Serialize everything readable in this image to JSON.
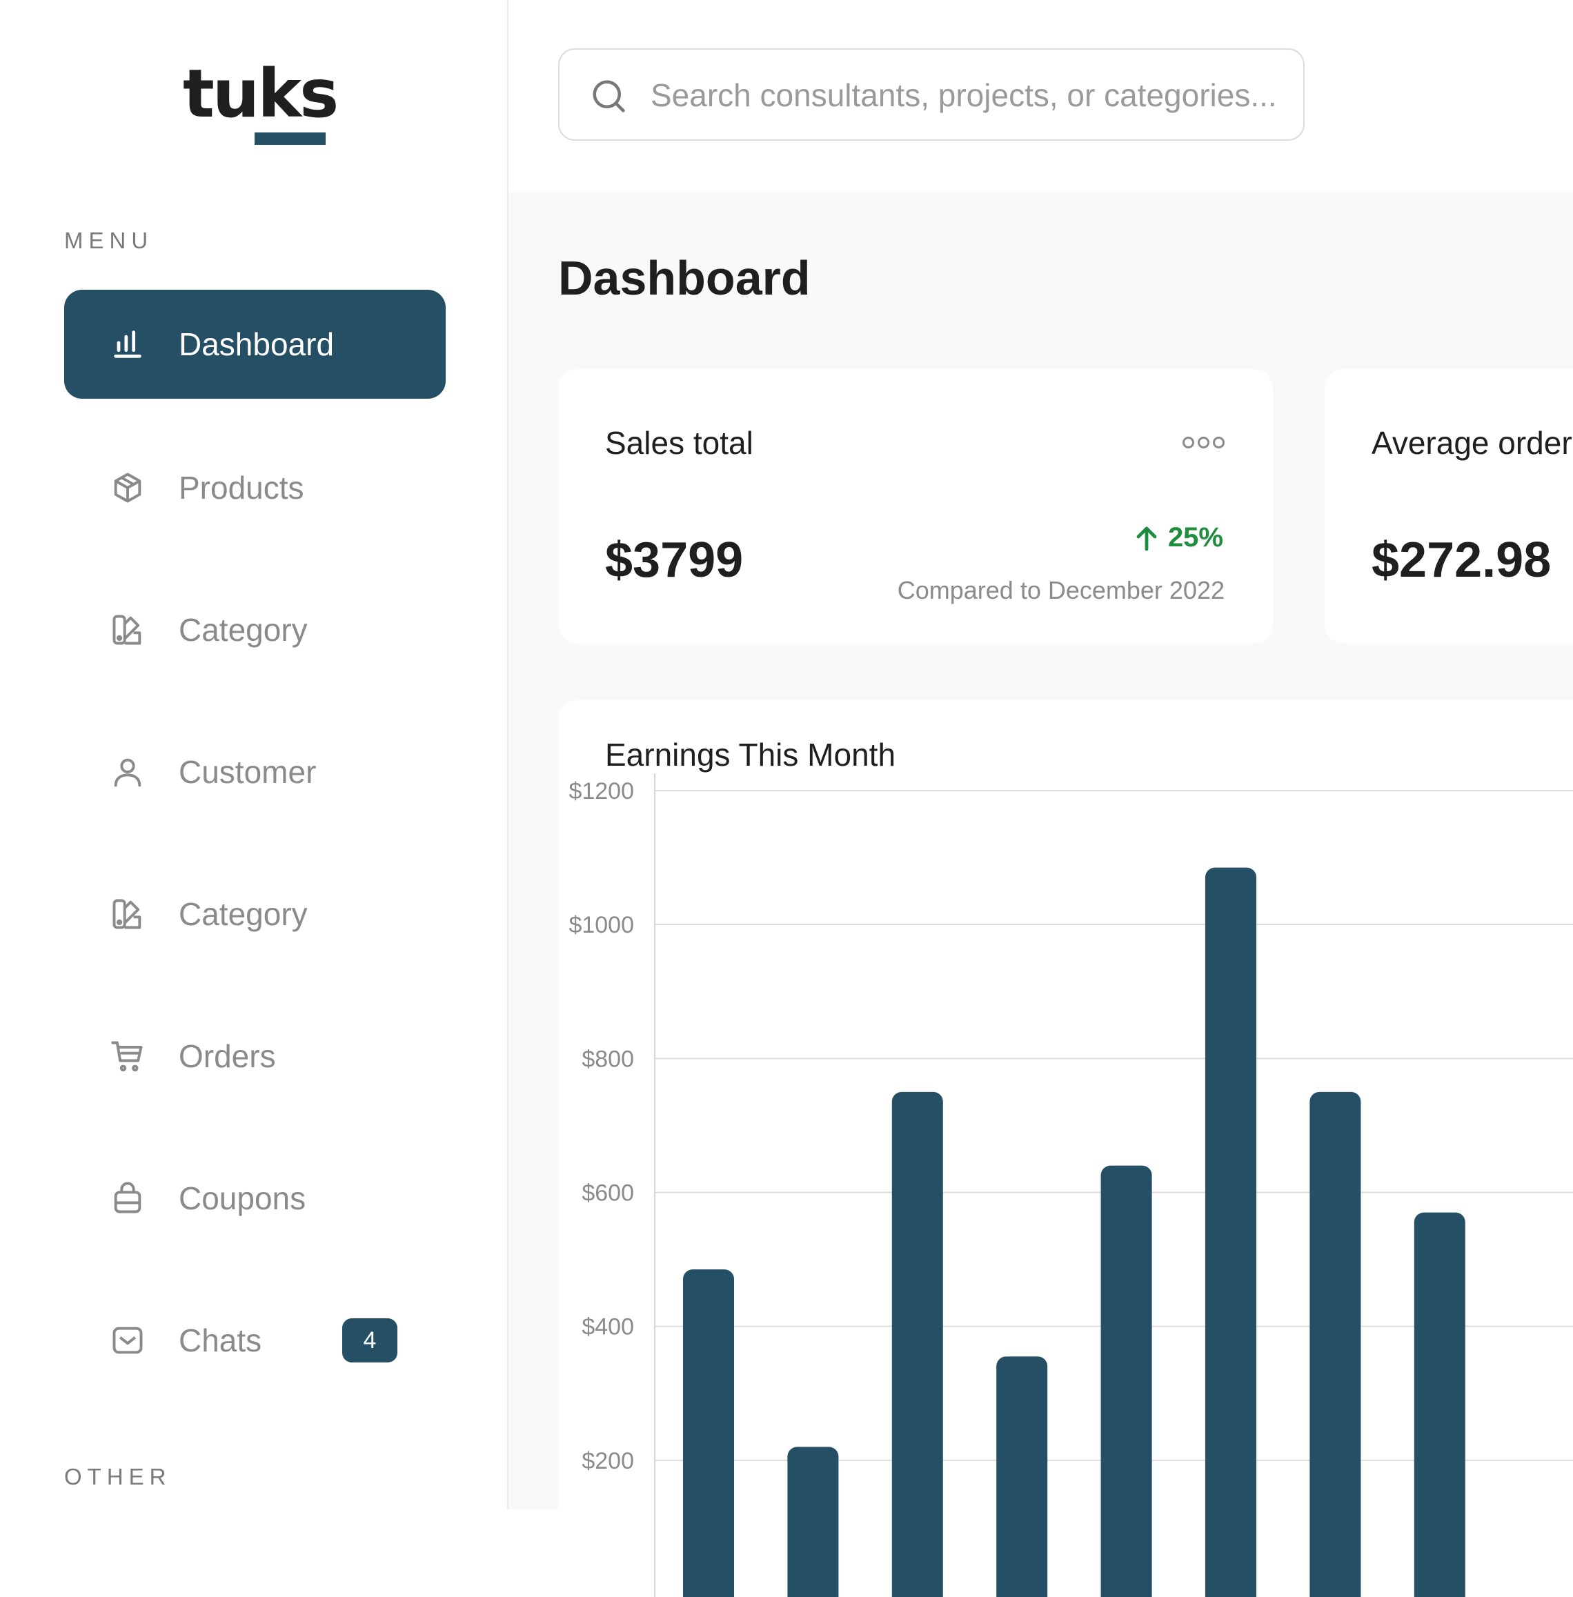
{
  "colors": {
    "accent": "#254f65",
    "positive": "#1e8e3e"
  },
  "logo": {
    "text": "tuks"
  },
  "sidebar": {
    "menu_label": "MENU",
    "items": [
      {
        "label": "Dashboard",
        "icon": "bar-chart-icon",
        "active": true
      },
      {
        "label": "Products",
        "icon": "box-icon"
      },
      {
        "label": "Category",
        "icon": "palette-icon"
      },
      {
        "label": "Customer",
        "icon": "user-icon"
      },
      {
        "label": "Category",
        "icon": "palette-icon"
      },
      {
        "label": "Orders",
        "icon": "cart-icon"
      },
      {
        "label": "Coupons",
        "icon": "bag-icon"
      },
      {
        "label": "Chats",
        "icon": "message-icon",
        "badge": "4"
      }
    ],
    "other_label": "OTHER"
  },
  "search": {
    "placeholder": "Search consultants, projects, or categories...",
    "value": ""
  },
  "main": {
    "title": "Dashboard",
    "sales_card": {
      "title": "Sales total",
      "value": "$3799",
      "trend": "25%",
      "compare": "Compared to December 2022"
    },
    "avg_card": {
      "title": "Average order",
      "value": "$272.98"
    }
  },
  "chart_data": {
    "type": "bar",
    "title": "Earnings This Month",
    "y_ticks": [
      "$1200",
      "$1000",
      "$800",
      "$600",
      "$400",
      "$200"
    ],
    "ylim": [
      0,
      1200
    ],
    "values": [
      485,
      220,
      750,
      355,
      640,
      1085,
      750,
      570
    ],
    "grid": true
  }
}
